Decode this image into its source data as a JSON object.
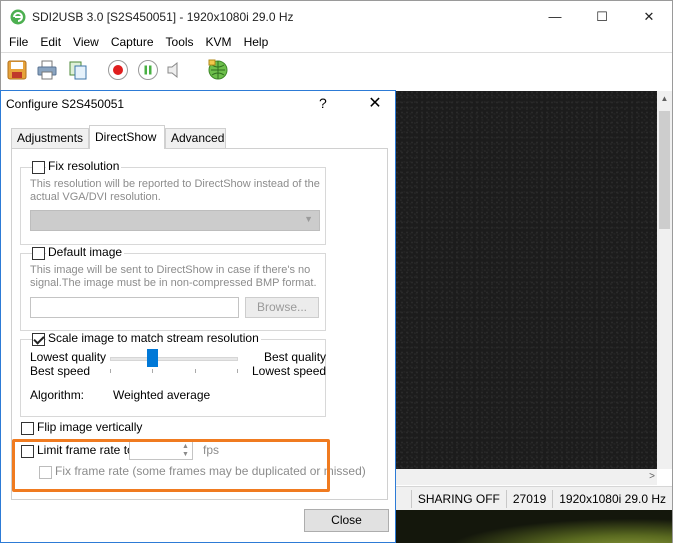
{
  "window": {
    "title": "SDI2USB 3.0 [S2S450051]  - 1920x1080i 29.0 Hz",
    "min_glyph": "—",
    "max_glyph": "☐",
    "close_glyph": "✕"
  },
  "menu": [
    "File",
    "Edit",
    "View",
    "Capture",
    "Tools",
    "KVM",
    "Help"
  ],
  "toolbar": {
    "icons": [
      "save-icon",
      "print-icon",
      "copy-icon",
      "record-icon",
      "pause-icon",
      "speaker-icon",
      "network-icon"
    ],
    "accent_colors": {
      "record": "#e01e1e",
      "pause": "#49b043",
      "highlight": "#f07b20",
      "slider": "#0078d7"
    }
  },
  "status": {
    "sharing": "SHARING OFF",
    "count": "27019",
    "resolution": "1920x1080i 29.0 Hz"
  },
  "dialog": {
    "title": "Configure S2S450051",
    "help": "?",
    "close": "✕",
    "tabs": [
      {
        "label": "Adjustments",
        "active": false
      },
      {
        "label": "DirectShow",
        "active": true
      },
      {
        "label": "Advanced",
        "active": false
      }
    ],
    "fix_resolution": {
      "label": "Fix resolution",
      "checked": false,
      "desc1": "This resolution will be reported to DirectShow instead of the",
      "desc2": "actual VGA/DVI resolution.",
      "combo_value": ""
    },
    "default_image": {
      "label": "Default image",
      "checked": false,
      "desc1": "This image will be sent to DirectShow in case if there's no",
      "desc2": "signal.The image must be in non-compressed BMP format.",
      "path_value": "",
      "browse_label": "Browse..."
    },
    "scale_image": {
      "label": "Scale image to match stream resolution",
      "checked": true,
      "left_top": "Lowest quality",
      "left_bottom": "Best speed",
      "right_top": "Best quality",
      "right_bottom": "Lowest speed",
      "slider_fraction": 0.33,
      "algorithm_label": "Algorithm:",
      "algorithm_value": "Weighted average"
    },
    "flip": {
      "label": "Flip image vertically",
      "checked": false
    },
    "limit_rate": {
      "label": "Limit frame rate to",
      "checked": false,
      "value": "",
      "unit": "fps",
      "fix_label": "Fix frame rate (some frames may be duplicated or missed)",
      "fix_checked": false
    },
    "close_button": "Close"
  }
}
